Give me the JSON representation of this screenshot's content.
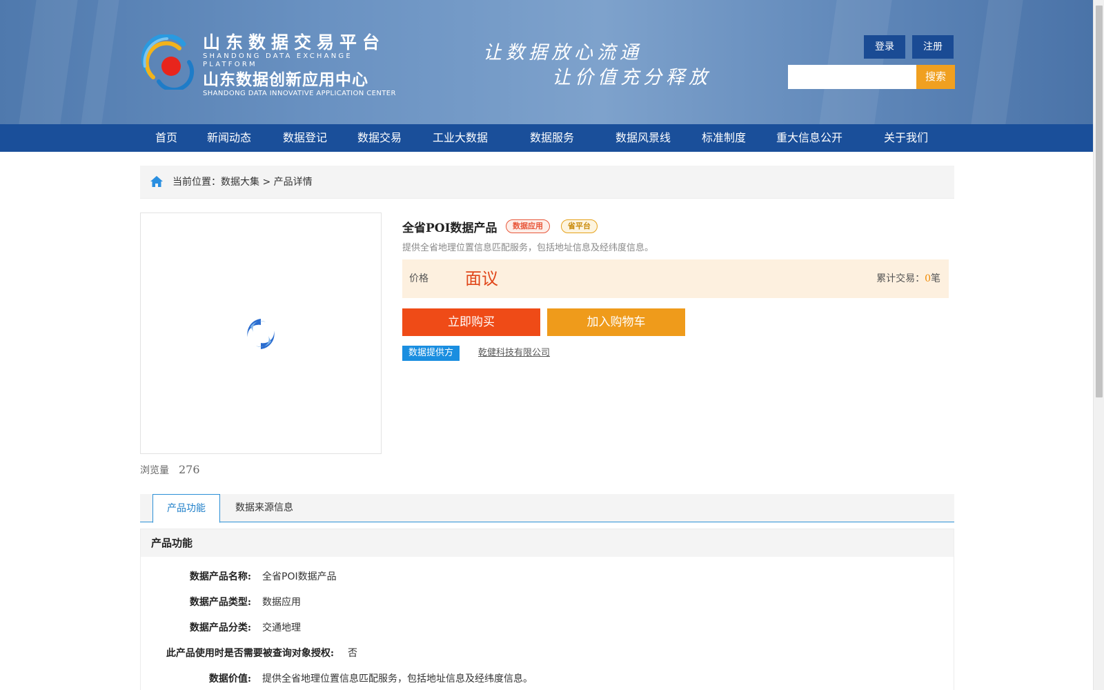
{
  "header": {
    "logo": {
      "cn_line1": "山东数据交易平台",
      "en_line1": "SHANDONG DATA EXCHANGE PLATFORM",
      "cn_line2": "山东数据创新应用中心",
      "en_line2": "SHANDONG DATA INNOVATIVE APPLICATION CENTER"
    },
    "slogan_line1": "让数据放心流通",
    "slogan_line2": "让价值充分释放",
    "login_label": "登录",
    "register_label": "注册",
    "search_value": "",
    "search_button": "搜索"
  },
  "nav": {
    "items": [
      "首页",
      "新闻动态",
      "数据登记",
      "数据交易",
      "工业大数据",
      "数据服务",
      "数据风景线",
      "标准制度",
      "重大信息公开",
      "关于我们"
    ]
  },
  "breadcrumb": {
    "prefix": "当前位置：",
    "crumb1": "数据大集",
    "separator": " > ",
    "crumb2": "产品详情"
  },
  "product": {
    "title": "全省POI数据产品",
    "tags": [
      "数据应用",
      "省平台"
    ],
    "description": "提供全省地理位置信息匹配服务，包括地址信息及经纬度信息。",
    "price_label": "价格",
    "price_value": "面议",
    "trade_label": "累计交易：",
    "trade_count": "0",
    "trade_unit": "笔",
    "buy_button": "立即购买",
    "cart_button": "加入购物车",
    "provider_label": "数据提供方",
    "provider_name": "乾健科技有限公司",
    "views_label": "浏览量",
    "views_count": "276"
  },
  "tabs": [
    "产品功能",
    "数据来源信息"
  ],
  "details": {
    "heading": "产品功能",
    "rows": [
      {
        "key": "数据产品名称:",
        "value": "全省POI数据产品"
      },
      {
        "key": "数据产品类型:",
        "value": "数据应用"
      },
      {
        "key": "数据产品分类:",
        "value": "交通地理"
      },
      {
        "key": "此产品使用时是否需要被查询对象授权:",
        "value": "否"
      },
      {
        "key": "数据价值:",
        "value": "提供全省地理位置信息匹配服务，包括地址信息及经纬度信息。"
      }
    ]
  },
  "colors": {
    "nav_bg": "#1a4f9a",
    "accent_blue": "#1a8ee0",
    "buy_red": "#ef4b17",
    "cart_orange": "#ef9b1b",
    "price_red": "#e0471b"
  }
}
